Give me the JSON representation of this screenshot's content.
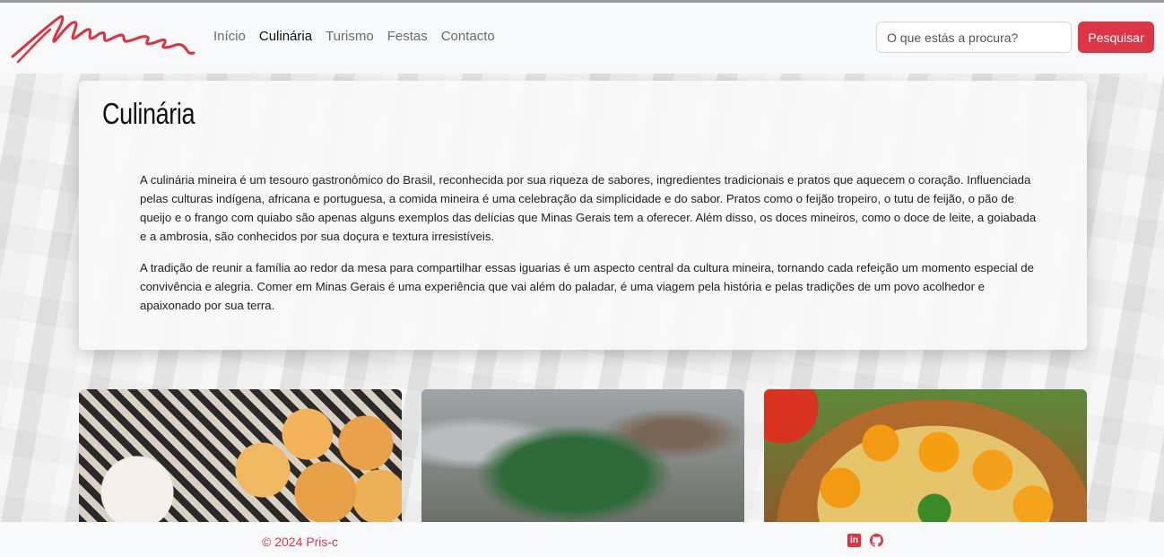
{
  "brand": {
    "logo_text": "Minas",
    "logo_icon": "minas-script-logo",
    "color": "#e0303e"
  },
  "nav": {
    "items": [
      {
        "label": "Início",
        "active": false
      },
      {
        "label": "Culinária",
        "active": true
      },
      {
        "label": "Turismo",
        "active": false
      },
      {
        "label": "Festas",
        "active": false
      },
      {
        "label": "Contacto",
        "active": false
      }
    ]
  },
  "search": {
    "placeholder": "O que estás a procura?",
    "value": "",
    "button_label": "Pesquisar",
    "button_color": "#dc3545"
  },
  "main": {
    "title": "Culinária",
    "paragraphs": [
      "A culinária mineira é um tesouro gastronômico do Brasil, reconhecida por sua riqueza de sabores, ingredientes tradicionais e pratos que aquecem o coração. Influenciada pelas culturas indígena, africana e portuguesa, a comida mineira é uma celebração da simplicidade e do sabor. Pratos como o feijão tropeiro, o tutu de feijão, o pão de queijo e o frango com quiabo são apenas alguns exemplos das delícias que Minas Gerais tem a oferecer. Além disso, os doces mineiros, como o doce de leite, a goiabada e a ambrosia, são conhecidos por sua doçura e textura irresistíveis.",
      "A tradição de reunir a família ao redor da mesa para compartilhar essas iguarias é um aspecto central da cultura mineira, tornando cada refeição um momento especial de convivência e alegria. Comer em Minas Gerais é uma experiência que vai além do paladar, é uma viagem pela história e pelas tradições de um povo acolhedor e apaixonado por sua terra."
    ]
  },
  "images": [
    {
      "name": "pao-de-queijo-image"
    },
    {
      "name": "food-preparation-image"
    },
    {
      "name": "rice-dish-image"
    }
  ],
  "footer": {
    "copyright": "© 2024 Pris-c",
    "social": [
      "linkedin-icon",
      "github-icon"
    ],
    "accent": "#dc3545"
  }
}
